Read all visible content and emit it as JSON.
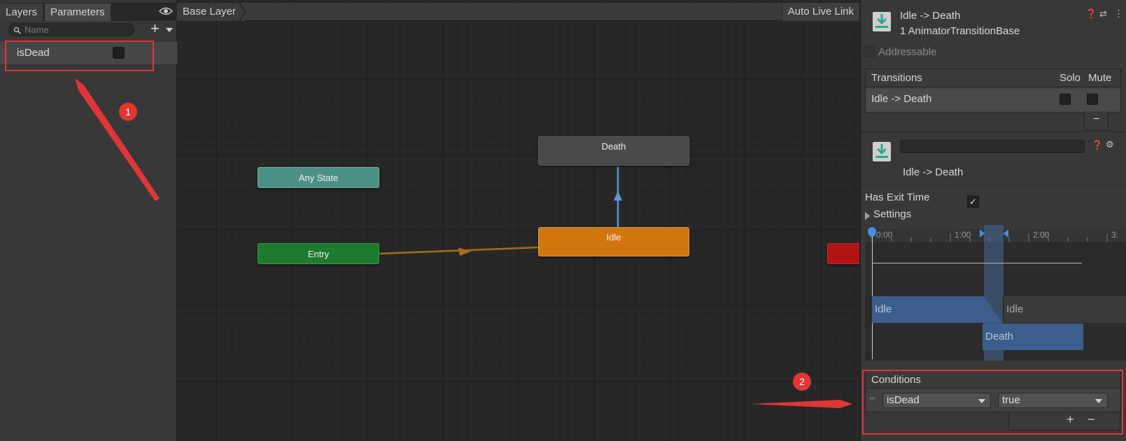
{
  "left_panel": {
    "tabs": [
      "Layers",
      "Parameters"
    ],
    "search_placeholder": "Name",
    "add_symbol": "+",
    "parameters": [
      {
        "name": "isDead",
        "value": false
      }
    ]
  },
  "graph": {
    "breadcrumb": "Base Layer",
    "auto_live_link": "Auto Live Link",
    "states": {
      "death": "Death",
      "any_state": "Any State",
      "idle": "Idle",
      "entry": "Entry"
    }
  },
  "inspector": {
    "header_title": "Idle -> Death",
    "header_subtitle": "1 AnimatorTransitionBase",
    "addressable": "Addressable",
    "transitions_label": "Transitions",
    "solo_label": "Solo",
    "mute_label": "Mute",
    "transition_row": "Idle -> Death",
    "minus": "−",
    "transition_name_display": "Idle -> Death",
    "has_exit_time_label": "Has Exit Time",
    "has_exit_time": true,
    "checkmark": "✓",
    "settings_label": "Settings",
    "timeline": {
      "ticks": [
        "0:00",
        "1:00",
        "2:00",
        "3:"
      ],
      "source_clip": "Idle",
      "source_clip_repeat": "Idle",
      "dest_clip": "Death"
    },
    "conditions_label": "Conditions",
    "condition": {
      "parameter": "isDead",
      "value": "true"
    },
    "plus": "+"
  },
  "annotations": {
    "badge_1": "1",
    "badge_2": "2",
    "highlight_color": "#e23535"
  }
}
